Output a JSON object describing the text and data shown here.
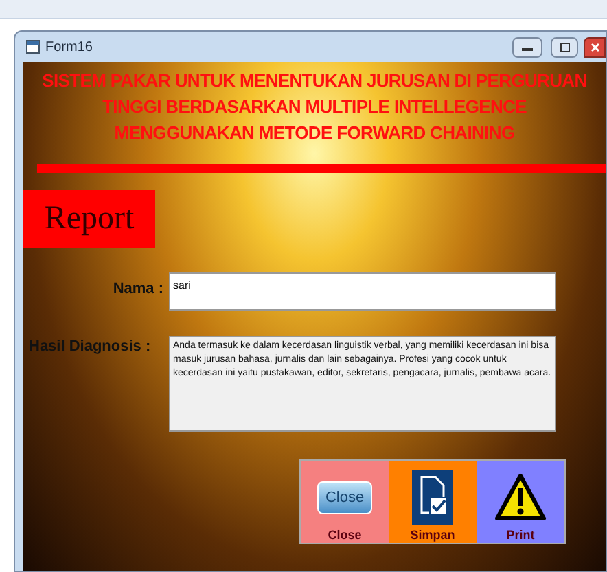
{
  "window": {
    "title": "Form16"
  },
  "heading": {
    "lines": [
      "SISTEM PAKAR UNTUK MENENTUKAN JURUSAN DI PERGURUAN",
      "TINGGI BERDASARKAN MULTIPLE INTELLEGENCE",
      "MENGGUNAKAN METODE FORWARD CHAINING"
    ]
  },
  "section_label": "Report",
  "fields": [
    {
      "label": "Nama :",
      "value": "sari",
      "kind": "line"
    },
    {
      "label": "Hasil Diagnosis :",
      "value": "Anda termasuk ke dalam kecerdasan linguistik verbal, yang memiliki kecerdasan ini bisa masuk  jurusan bahasa, jurnalis dan lain sebagainya. Profesi yang cocok untuk kecerdasan ini yaitu pustakawan, editor, sekretaris, pengacara, jurnalis, pembawa acara.",
      "kind": "area"
    }
  ],
  "buttons": [
    {
      "label": "Close",
      "kind": "close",
      "icon_text": "Close",
      "color": "#f58080"
    },
    {
      "label": "Simpan",
      "kind": "save",
      "color": "#ff8000"
    },
    {
      "label": "Print",
      "kind": "print",
      "color": "#8080ff"
    }
  ]
}
